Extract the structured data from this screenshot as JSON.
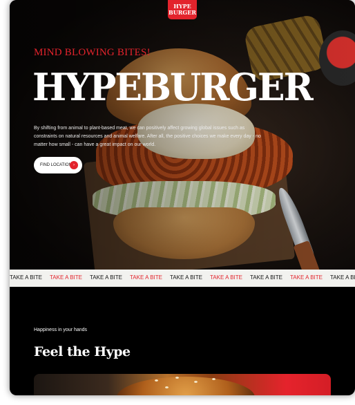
{
  "logo": {
    "line1": "HYPE",
    "line2": "BURGER"
  },
  "hero": {
    "tagline": "MIND BLOWING BITES!",
    "title": "HYPEBURGER",
    "description": "By shifting from animal to plant-based meat, we can positively affect growing global issues such as constraints on natural resources and animal welfare. After all, the positive choices we make every day - no matter how small - can have a great impact on our world.",
    "cta_label": "FIND LOCATION",
    "cta_icon": "arrow-right-icon"
  },
  "marquee": {
    "items": [
      "TAKE A BITE",
      "TAKE A BITE",
      "TAKE A BITE",
      "TAKE A BITE",
      "TAKE A BITE",
      "TAKE A BITE",
      "TAKE A BITE",
      "TAKE A BITE",
      "TAKE A BITE"
    ]
  },
  "section": {
    "label": "Happiness in your hands",
    "title": "Feel the Hype"
  },
  "colors": {
    "accent": "#e3232c",
    "background": "#000000",
    "marquee_bg": "#f2f2ef"
  }
}
